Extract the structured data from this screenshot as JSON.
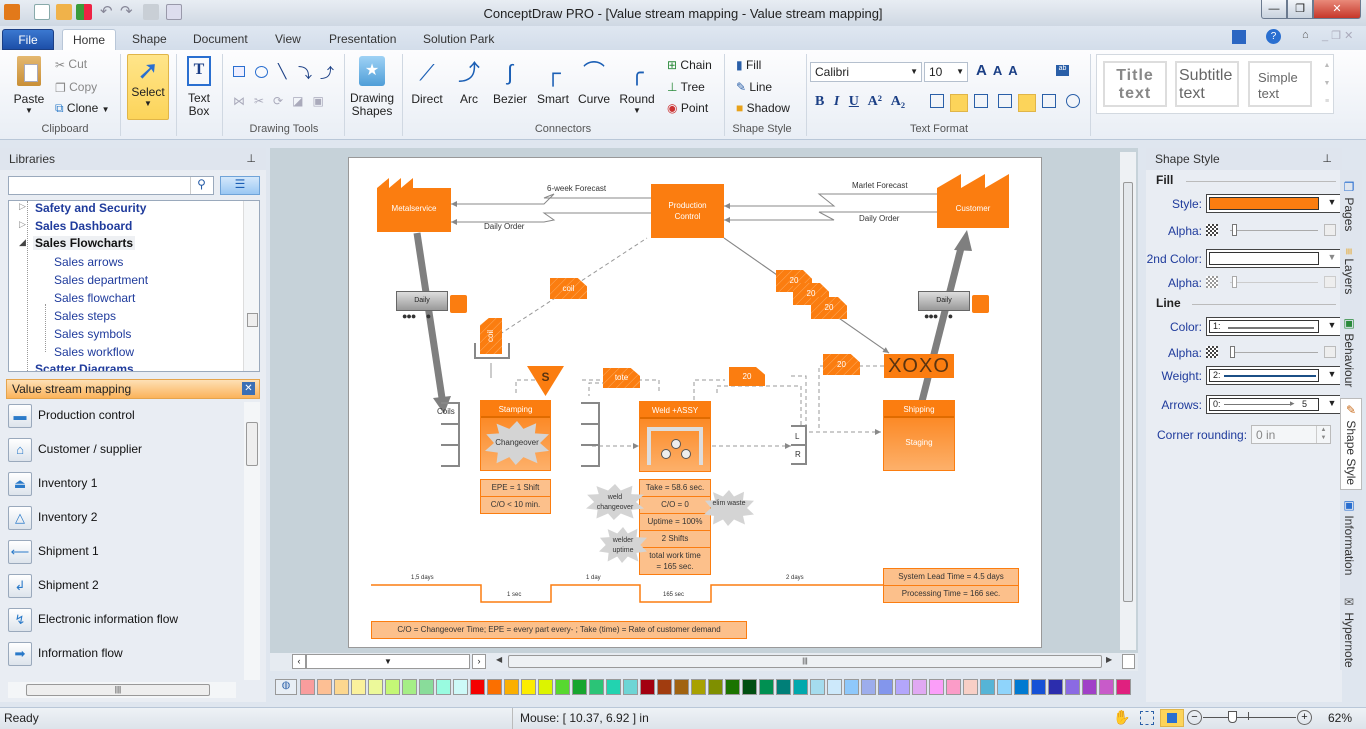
{
  "window": {
    "title": "ConceptDraw PRO - [Value stream mapping - Value stream mapping]",
    "controls": [
      "minimize",
      "restore",
      "close"
    ]
  },
  "ribbon": {
    "tabs": [
      {
        "label": "File"
      },
      {
        "label": "Home"
      },
      {
        "label": "Shape"
      },
      {
        "label": "Document"
      },
      {
        "label": "View"
      },
      {
        "label": "Presentation"
      },
      {
        "label": "Solution Park"
      }
    ],
    "active_tab": "Home",
    "clipboard": {
      "paste": "Paste",
      "cut": "Cut",
      "copy": "Copy",
      "clone": "Clone",
      "group": "Clipboard"
    },
    "select": {
      "label": "Select"
    },
    "textbox": {
      "line1": "Text",
      "line2": "Box"
    },
    "drawing_tools": {
      "group": "Drawing Tools"
    },
    "drawing_shapes": {
      "line1": "Drawing",
      "line2": "Shapes"
    },
    "connectors": {
      "items": [
        "Direct",
        "Arc",
        "Bezier",
        "Smart",
        "Curve",
        "Round"
      ],
      "chain": "Chain",
      "tree": "Tree",
      "point": "Point",
      "group": "Connectors"
    },
    "shape_style": {
      "fill": "Fill",
      "line": "Line",
      "shadow": "Shadow",
      "group": "Shape Style"
    },
    "text_format": {
      "font": "Calibri",
      "size": "10",
      "group": "Text Format"
    },
    "text_styles": [
      {
        "line1": "Title",
        "line2": "text"
      },
      {
        "line1": "Subtitle",
        "line2": "text"
      },
      {
        "line1": "Simple",
        "line2": "text"
      }
    ]
  },
  "libraries": {
    "title": "Libraries",
    "search_placeholder": "",
    "tree": [
      {
        "label": "Safety and Security",
        "expanded": false
      },
      {
        "label": "Sales Dashboard",
        "expanded": false
      },
      {
        "label": "Sales Flowcharts",
        "expanded": true,
        "selected": true
      }
    ],
    "subitems": [
      "Sales arrows",
      "Sales department",
      "Sales flowchart",
      "Sales steps",
      "Sales symbols",
      "Sales workflow"
    ],
    "tree_more": "Scatter Diagrams",
    "active_library": "Value stream mapping",
    "shapes": [
      {
        "label": "Production control",
        "icon": "rectangle-icon"
      },
      {
        "label": "Customer / supplier",
        "icon": "factory-icon"
      },
      {
        "label": "Inventory 1",
        "icon": "inventory-icon"
      },
      {
        "label": "Inventory 2",
        "icon": "triangle-icon"
      },
      {
        "label": "Shipment 1",
        "icon": "arrow-left-icon"
      },
      {
        "label": "Shipment 2",
        "icon": "arrow-turn-icon"
      },
      {
        "label": "Electronic information flow",
        "icon": "zigzag-arrow-icon"
      },
      {
        "label": "Information flow",
        "icon": "arrow-right-icon"
      }
    ]
  },
  "diagram": {
    "supplier": "Metalservice",
    "production_control": {
      "line1": "Production",
      "line2": "Control"
    },
    "customer": "Customer",
    "forecast_left": "6-week Forecast",
    "order_left": "Daily Order",
    "forecast_right": "Marlet Forecast",
    "order_right": "Daily Order",
    "truck_left": "Daily",
    "truck_right": "Daily",
    "kanban_coil1": "coil",
    "kanban_coil2": "coil",
    "kanban_20": [
      "20",
      "20",
      "20"
    ],
    "kanban_tote": "tote",
    "kanban_20_b": "20",
    "kanban_20_c": "20",
    "xoxo": "XOXO",
    "supermarket": "S",
    "coils_label": "Coils",
    "stamping": {
      "title": "Stamping",
      "burst": "Changeover",
      "data": [
        "EPE = 1 Shift",
        "C/O < 10 min."
      ]
    },
    "weld": {
      "title": "Weld +ASSY",
      "data": [
        "Take = 58.6 sec.",
        "C/O = 0",
        "Uptime = 100%",
        "2 Shifts",
        "total work time = 165 sec."
      ]
    },
    "bursts": {
      "weld_changeover": "weld changeover",
      "welder_uptime": "welder uptime",
      "elim_waste": "elim waste"
    },
    "lr": {
      "l": "L",
      "r": "R"
    },
    "shipping": {
      "title": "Shipping",
      "body": "Staging"
    },
    "timeline": {
      "t1": "1,5 days",
      "t2": "1 sec",
      "t3": "1 day",
      "t4": "165 sec",
      "t5": "2 days"
    },
    "summary": {
      "lead": "System Lead Time = 4.5 days",
      "proc": "Processing Time = 166 sec."
    },
    "legend": "C/O = Changeover Time; EPE = every part every- ; Take (time) = Rate of customer demand"
  },
  "shape_style_panel": {
    "title": "Shape Style",
    "fill_header": "Fill",
    "style_label": "Style:",
    "style_color": "#fb7d10",
    "alpha_label": "Alpha:",
    "second_color_label": "2nd Color:",
    "second_color": "#ffffff",
    "line_header": "Line",
    "color_label": "Color:",
    "color_value": "1:",
    "weight_label": "Weight:",
    "weight_value": "2:",
    "arrows_label": "Arrows:",
    "arrows_start": "0:",
    "arrows_end": "5",
    "corner_label": "Corner rounding:",
    "corner_value": "0 in"
  },
  "side_tabs": [
    "Pages",
    "Layers",
    "Behaviour",
    "Shape Style",
    "Information",
    "Hypernote"
  ],
  "palette": [
    "#f99d9d",
    "#fdbf94",
    "#fcd78f",
    "#faf19c",
    "#ecf99a",
    "#c4f776",
    "#a5ee86",
    "#89dc9a",
    "#99fbe0",
    "#cdf9f8",
    "#f50000",
    "#fb6f00",
    "#fbaf00",
    "#fcec00",
    "#dcf400",
    "#57d82f",
    "#17a52f",
    "#2bc477",
    "#22d3b0",
    "#6dd5d5",
    "#a30010",
    "#a13c0f",
    "#a16310",
    "#a8a100",
    "#7f8f00",
    "#1b7400",
    "#004f12",
    "#009052",
    "#007f78",
    "#00a8ad",
    "#a5dcee",
    "#cde9fb",
    "#8ec8fb",
    "#9dadec",
    "#8396ec",
    "#b3a6fb",
    "#e0a9f3",
    "#fb9ef9",
    "#fb9cc8",
    "#f8cfc6",
    "#56b4d6",
    "#8fd4fb",
    "#007ad1",
    "#1551d6",
    "#2c2dad",
    "#8b6ae3",
    "#a040c8",
    "#c85bc9",
    "#e0207f"
  ],
  "status": {
    "ready": "Ready",
    "mouse": "Mouse: [ 10.37, 6.92 ] in",
    "zoom": "62%",
    "zoom_level": 0.62
  }
}
